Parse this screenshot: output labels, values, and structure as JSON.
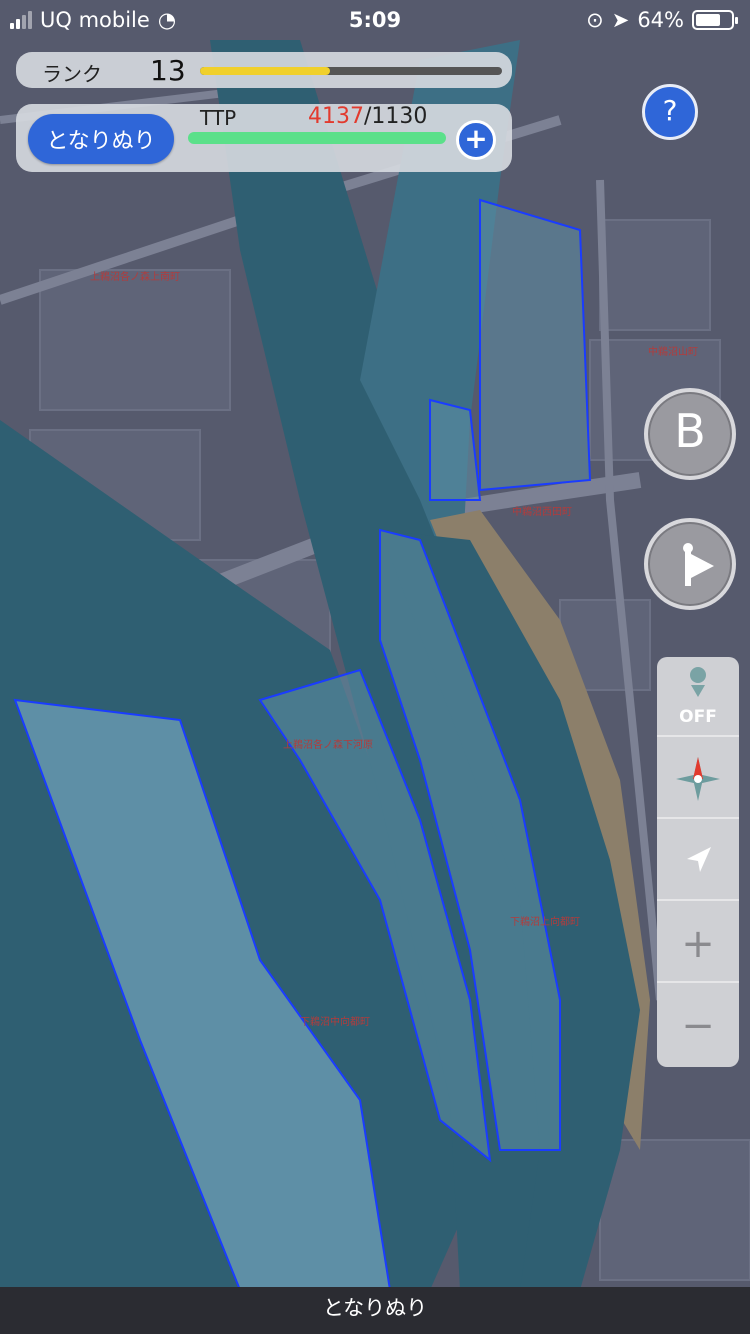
{
  "status_bar": {
    "carrier": "UQ mobile",
    "time": "5:09",
    "battery_percent": "64%"
  },
  "rank": {
    "label": "ランク",
    "value": "13",
    "progress": 0.43
  },
  "ttp": {
    "mode_button_label": "となりぬり",
    "label": "TTP",
    "current": "4137",
    "total": "/1130",
    "progress": 1.0
  },
  "controls": {
    "b_button_label": "B",
    "off_label": "OFF",
    "zoom_in": "+",
    "zoom_out": "−"
  },
  "map": {
    "labels": [
      "上鵜沼各ノ森上南町",
      "中鵜沼山町",
      "中鵜沼西田町",
      "上鵜沼各ノ森下河原",
      "下鵜沼上向都町",
      "下鵜沼中向都町"
    ],
    "colors": {
      "land": "#565a6d",
      "river": "#2f5f72",
      "territory": "#5e8fa6",
      "sand": "#8c7f6a",
      "outline": "#1a3cff"
    }
  },
  "bottom_bar": {
    "title": "となりぬり"
  }
}
